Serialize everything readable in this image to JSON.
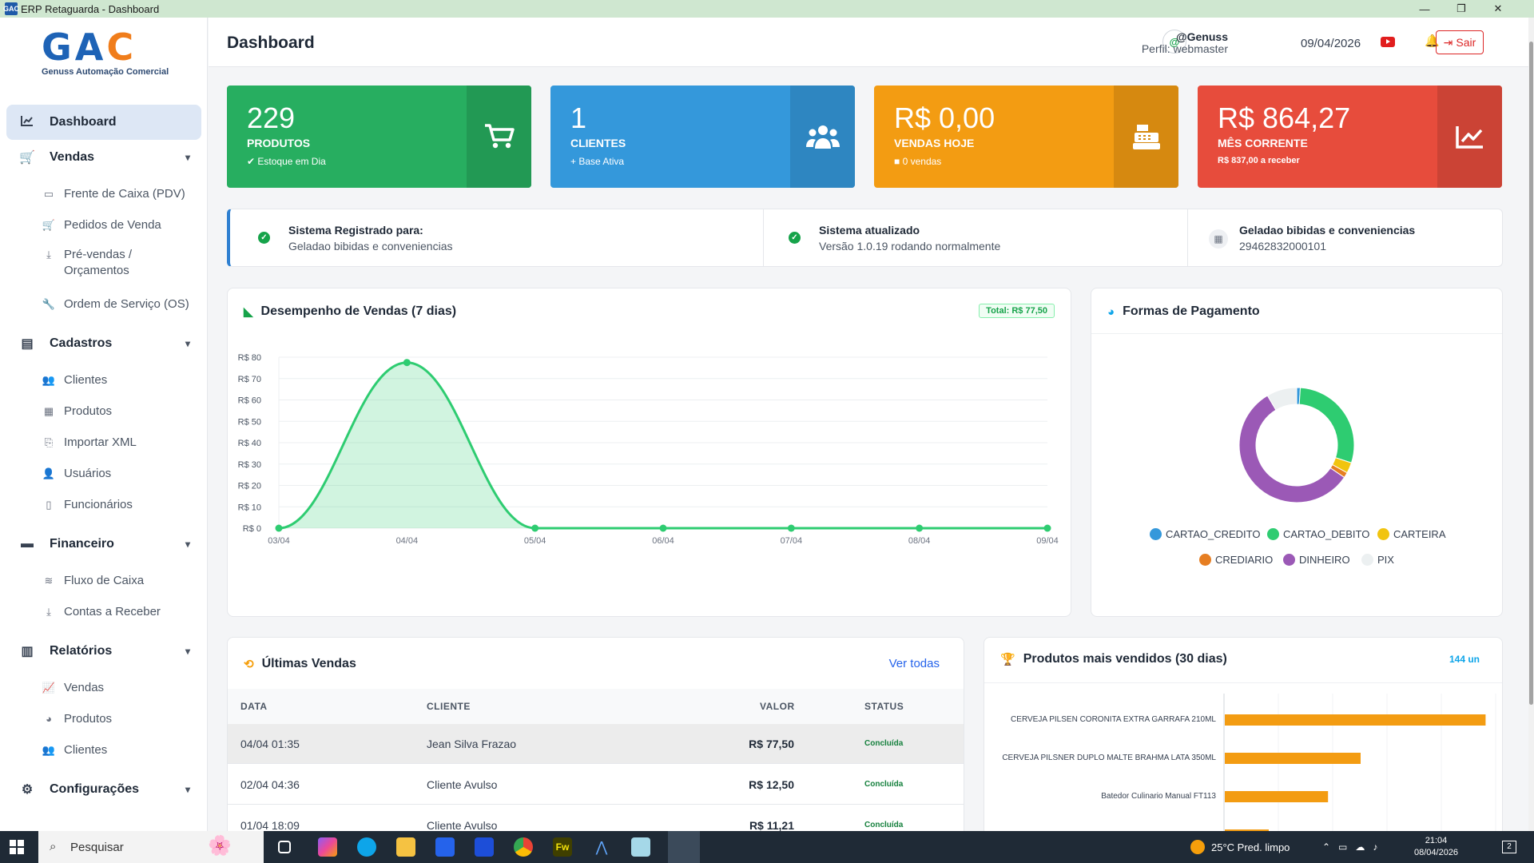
{
  "window": {
    "title": "ERP Retaguarda - Dashboard",
    "app_icon": "GAC",
    "minimize": "—",
    "restore": "❐",
    "close": "✕"
  },
  "logo": {
    "g": "G",
    "a": "A",
    "c": "C",
    "tagline": "Genuss Automação Comercial"
  },
  "sidebar": {
    "dashboard": "Dashboard",
    "vendas": {
      "label": "Vendas",
      "items": [
        "Frente de Caixa (PDV)",
        "Pedidos de Venda",
        "Pré-vendas / Orçamentos",
        "Ordem de Serviço (OS)"
      ]
    },
    "cadastros": {
      "label": "Cadastros",
      "items": [
        "Clientes",
        "Produtos",
        "Importar XML",
        "Usuários",
        "Funcionários"
      ]
    },
    "financeiro": {
      "label": "Financeiro",
      "items": [
        "Fluxo de Caixa",
        "Contas a Receber"
      ]
    },
    "relatorios": {
      "label": "Relatórios",
      "items": [
        "Vendas",
        "Produtos",
        "Clientes"
      ]
    },
    "configuracoes": {
      "label": "Configurações"
    }
  },
  "header": {
    "title": "Dashboard",
    "avatar": "@",
    "user": "@Genuss",
    "role": "Perfil: webmaster",
    "date": "09/04/2026",
    "logout": "Sair"
  },
  "stats": [
    {
      "value": "229",
      "label": "PRODUTOS",
      "sub": "Estoque em Dia",
      "sub_icon": "✔",
      "color": "#27ae60",
      "side_color": "#229954",
      "icon": "cart-icon"
    },
    {
      "value": "1",
      "label": "CLIENTES",
      "sub": "Base Ativa",
      "sub_icon": "+",
      "color": "#3498db",
      "side_color": "#2e86c1",
      "icon": "users-icon"
    },
    {
      "value": "R$ 0,00",
      "label": "VENDAS HOJE",
      "sub": "0 vendas",
      "sub_icon": "■",
      "color": "#f39c12",
      "side_color": "#d68910",
      "icon": "cash-register-icon"
    },
    {
      "value": "R$ 864,27",
      "label": "MÊS CORRENTE",
      "sub": "R$ 837,00 a receber",
      "sub_icon": "",
      "color": "#e74c3c",
      "side_color": "#cb4335",
      "icon": "chart-line-icon"
    }
  ],
  "info": [
    {
      "title": "Sistema Registrado para:",
      "value": "Geladao bibidas e conveniencias"
    },
    {
      "title": "Sistema atualizado",
      "value": "Versão 1.0.19 rodando normalmente"
    },
    {
      "title": "Geladao bibidas e conveniencias",
      "value": "29462832000101"
    }
  ],
  "sales_chart": {
    "title": "Desempenho de Vendas (7 dias)",
    "badge": "Total: R$ 77,50",
    "chart_data": {
      "type": "area",
      "categories": [
        "03/04",
        "04/04",
        "05/04",
        "06/04",
        "07/04",
        "08/04",
        "09/04"
      ],
      "values": [
        0,
        77.5,
        0,
        0,
        0,
        0,
        0
      ],
      "ylim": [
        0,
        80
      ],
      "yticks": [
        "R$ 0",
        "R$ 10",
        "R$ 20",
        "R$ 30",
        "R$ 40",
        "R$ 50",
        "R$ 60",
        "R$ 70",
        "R$ 80"
      ],
      "color": "#2ecc71",
      "grid": true
    }
  },
  "payment_chart": {
    "title": "Formas de Pagamento",
    "chart_data": {
      "type": "pie",
      "labels": [
        "CARTAO_CREDITO",
        "CARTAO_DEBITO",
        "CARTEIRA",
        "CREDIARIO",
        "DINHEIRO",
        "PIX"
      ],
      "values": [
        1,
        29,
        3,
        1.5,
        57,
        8.5
      ],
      "colors": [
        "#3498db",
        "#2ecc71",
        "#f1c40f",
        "#e67e22",
        "#9b59b6",
        "#ecf0f1"
      ]
    }
  },
  "recent_sales": {
    "title": "Últimas Vendas",
    "link": "Ver todas",
    "columns": [
      "DATA",
      "CLIENTE",
      "VALOR",
      "STATUS"
    ],
    "rows": [
      {
        "date": "04/04 01:35",
        "client": "Jean Silva Frazao",
        "value": "R$ 77,50",
        "status": "Concluída"
      },
      {
        "date": "02/04 04:36",
        "client": "Cliente Avulso",
        "value": "R$ 12,50",
        "status": "Concluída"
      },
      {
        "date": "01/04 18:09",
        "client": "Cliente Avulso",
        "value": "R$ 11,21",
        "status": "Concluída"
      }
    ]
  },
  "top_products": {
    "title": "Produtos mais vendidos (30 dias)",
    "badge": "144 un",
    "chart_data": {
      "type": "bar",
      "orientation": "horizontal",
      "categories": [
        "CERVEJA PILSEN CORONITA EXTRA GARRAFA 210ML",
        "CERVEJA PILSNER DUPLO MALTE BRAHMA LATA 350ML",
        "Batedor Culinario Manual FT113"
      ],
      "values": [
        48,
        25,
        19
      ],
      "xlim": [
        0,
        50
      ],
      "color": "#f39c12"
    }
  },
  "taskbar": {
    "search": "Pesquisar",
    "weather": "25°C  Pred. limpo",
    "time": "21:04",
    "date": "08/04/2026",
    "notif_count": "2"
  }
}
